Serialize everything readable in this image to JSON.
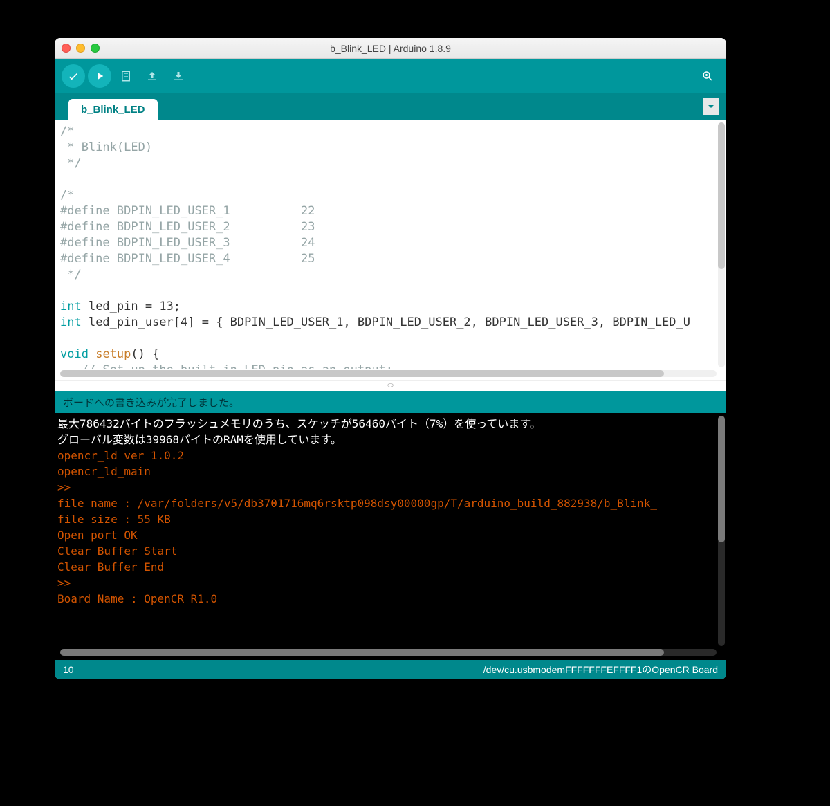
{
  "window": {
    "title": "b_Blink_LED | Arduino 1.8.9"
  },
  "tab": {
    "label": "b_Blink_LED"
  },
  "code": {
    "l1": "/*",
    "l2": " * Blink(LED)",
    "l3": " */",
    "l4": "",
    "l5": "/*",
    "l6a": "#define BDPIN_LED_USER_1          ",
    "l6b": "22",
    "l7a": "#define BDPIN_LED_USER_2          ",
    "l7b": "23",
    "l8a": "#define BDPIN_LED_USER_3          ",
    "l8b": "24",
    "l9a": "#define BDPIN_LED_USER_4          ",
    "l9b": "25",
    "l10": " */",
    "l11": "",
    "l12a": "int",
    "l12b": " led_pin = ",
    "l12c": "13",
    "l12d": ";",
    "l13a": "int",
    "l13b": " led_pin_user[",
    "l13c": "4",
    "l13d": "] = { BDPIN_LED_USER_1, BDPIN_LED_USER_2, BDPIN_LED_USER_3, BDPIN_LED_U",
    "l14": "",
    "l15a": "void",
    "l15b": " ",
    "l15c": "setup",
    "l15d": "() {",
    "l16": "   // Set up the built-in LED pin as an output:"
  },
  "status": {
    "upload_done": "ボードへの書き込みが完了しました。"
  },
  "console": {
    "l1": "最大786432バイトのフラッシュメモリのうち、スケッチが56460バイト（7%）を使っています。",
    "l2": "グローバル変数は39968バイトのRAMを使用しています。",
    "l3": "opencr_ld ver 1.0.2",
    "l4": "opencr_ld_main",
    "l5": ">>",
    "l6": "file name : /var/folders/v5/db3701716mq6rsktp098dsy00000gp/T/arduino_build_882938/b_Blink_",
    "l7": "file size : 55 KB",
    "l8": "Open port OK",
    "l9": "Clear Buffer Start",
    "l10": "Clear Buffer End",
    "l11": ">>",
    "l12": "Board Name : OpenCR R1.0"
  },
  "footer": {
    "line": "10",
    "board": "/dev/cu.usbmodemFFFFFFFEFFFF1のOpenCR Board"
  }
}
